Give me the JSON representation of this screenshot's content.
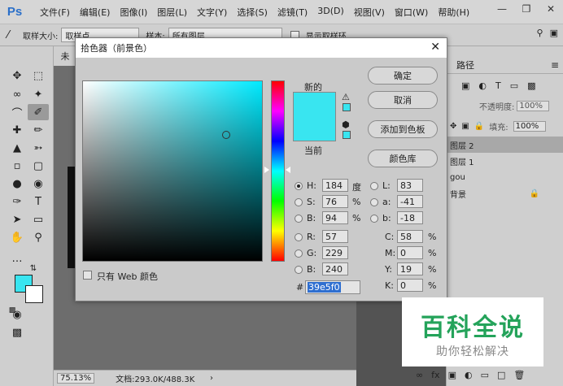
{
  "app": {
    "logo": "Ps"
  },
  "menu": [
    "文件(F)",
    "编辑(E)",
    "图像(I)",
    "图层(L)",
    "文字(Y)",
    "选择(S)",
    "滤镜(T)",
    "3D(D)",
    "视图(V)",
    "窗口(W)",
    "帮助(H)"
  ],
  "options_bar": {
    "sample_size_label": "取样大小:",
    "sample_size_value": "取样点",
    "sample_label": "样本:",
    "sample_value": "所有图层",
    "show_ring_label": "显示取样环"
  },
  "doc": {
    "tab": "未",
    "zoom": "75.13%",
    "doc_info": "文档:293.0K/488.3K"
  },
  "panels": {
    "tab_paths": "路径",
    "opacity_label": "不透明度:",
    "opacity_value": "100%",
    "fill_label": "填充:",
    "fill_value": "100%",
    "layers": [
      "图层 2",
      "图层 1",
      "gou",
      "背景"
    ]
  },
  "dialog": {
    "title": "拾色器（前景色）",
    "new_label": "新的",
    "current_label": "当前",
    "buttons": {
      "ok": "确定",
      "cancel": "取消",
      "add_swatch": "添加到色板",
      "libraries": "颜色库"
    },
    "fields": {
      "H": {
        "label": "H:",
        "value": "184",
        "unit": "度"
      },
      "S": {
        "label": "S:",
        "value": "76",
        "unit": "%"
      },
      "Bv": {
        "label": "B:",
        "value": "94",
        "unit": "%"
      },
      "R": {
        "label": "R:",
        "value": "57"
      },
      "G": {
        "label": "G:",
        "value": "229"
      },
      "B": {
        "label": "B:",
        "value": "240"
      },
      "L": {
        "label": "L:",
        "value": "83"
      },
      "a": {
        "label": "a:",
        "value": "-41"
      },
      "b": {
        "label": "b:",
        "value": "-18"
      },
      "C": {
        "label": "C:",
        "value": "58",
        "unit": "%"
      },
      "M": {
        "label": "M:",
        "value": "0",
        "unit": "%"
      },
      "Y": {
        "label": "Y:",
        "value": "19",
        "unit": "%"
      },
      "K": {
        "label": "K:",
        "value": "0",
        "unit": "%"
      }
    },
    "hex_label": "#",
    "hex_value": "39e5f0",
    "web_only_label": "只有 Web 颜色"
  },
  "colors": {
    "foreground": "#39e5f0",
    "background": "#ffffff"
  },
  "watermark": {
    "main": "百科全说",
    "sub": "助你轻松解决"
  }
}
